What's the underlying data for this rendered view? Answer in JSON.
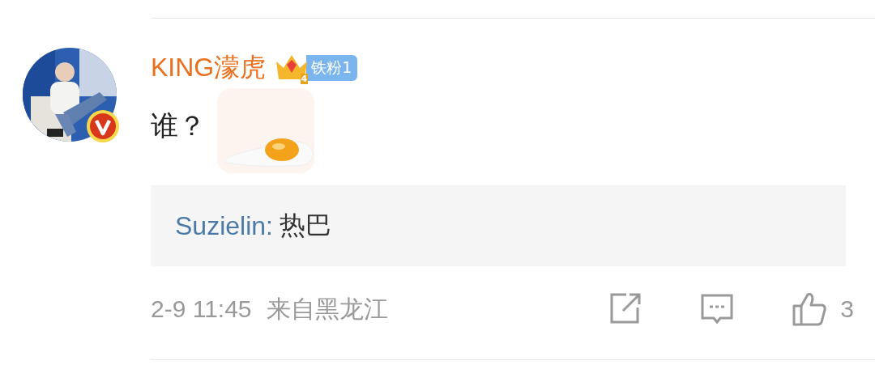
{
  "comment": {
    "author": "KING濛虎",
    "verified": true,
    "crown_level": "4",
    "fan_badge": "铁粉1",
    "text": "谁？",
    "reply": {
      "author": "Suzielin:",
      "text": "热巴"
    },
    "time": "2-9 11:45",
    "location": "来自黑龙江",
    "like_count": "3"
  }
}
